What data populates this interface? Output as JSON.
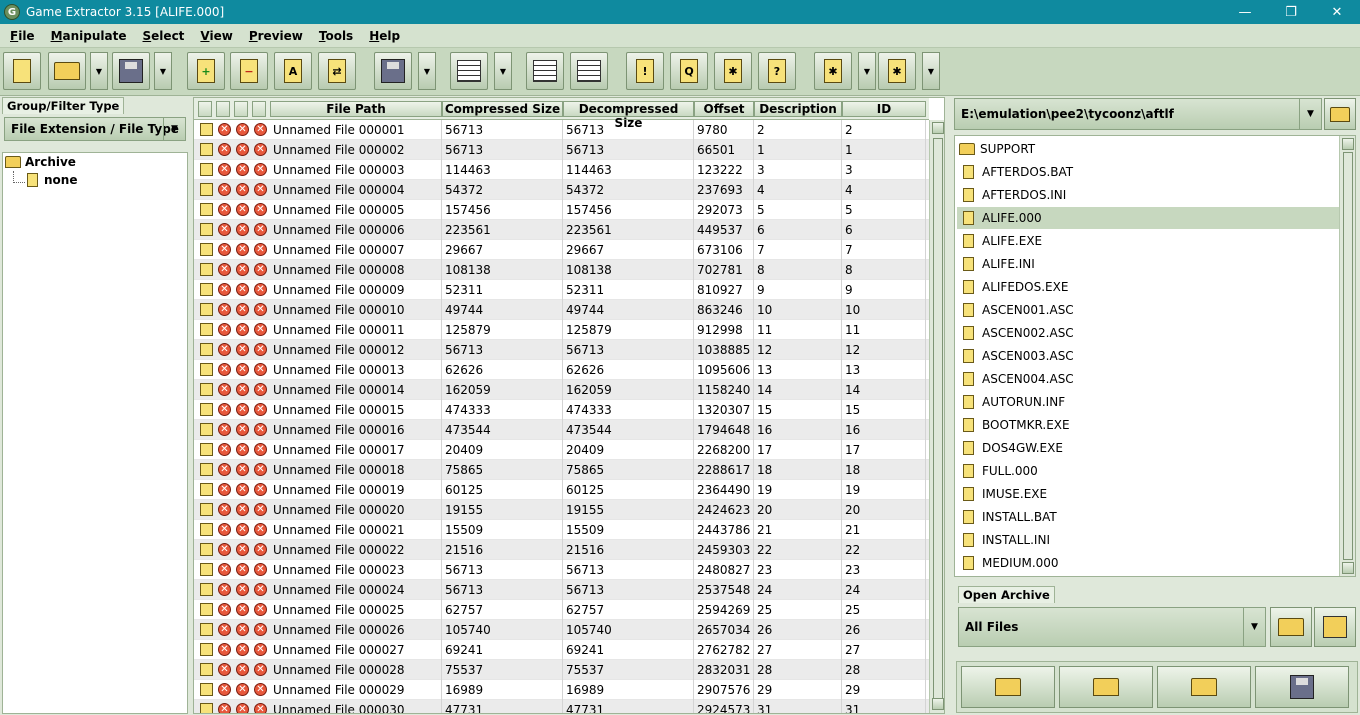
{
  "window": {
    "title": "Game Extractor 3.15 [ALIFE.000]",
    "minimize": "—",
    "maximize": "❐",
    "close": "✕"
  },
  "menu": [
    "File",
    "Manipulate",
    "Select",
    "View",
    "Preview",
    "Tools",
    "Help"
  ],
  "menu_underline": [
    "F",
    "M",
    "S",
    "V",
    "P",
    "T",
    "H"
  ],
  "toolbar": {
    "icons": [
      "new-archive-icon",
      "open-archive-icon",
      "open-dropdown-icon",
      "save-archive-icon",
      "save-dropdown-icon",
      "add-files-icon",
      "remove-files-icon",
      "rename-files-icon",
      "replace-files-icon",
      "extract-icon",
      "extract-dropdown-icon",
      "table-view-icon",
      "view-dropdown-icon",
      "tree-view-icon",
      "thumbnail-view-icon",
      "plugin-icon",
      "search-icon",
      "options-icon",
      "help-icon",
      "script-icon",
      "script-dropdown-icon",
      "settings-icon",
      "settings-dropdown-icon"
    ]
  },
  "left_panel": {
    "tab": "Group/Filter Type",
    "filter_value": "File Extension / File Type",
    "tree_root": "Archive",
    "tree_child": "none"
  },
  "table": {
    "columns": [
      "File Path",
      "Compressed Size",
      "Decompressed Size",
      "Offset",
      "Description",
      "ID"
    ],
    "rows": [
      [
        "Unnamed File 000001",
        "56713",
        "56713",
        "9780",
        "2",
        "2"
      ],
      [
        "Unnamed File 000002",
        "56713",
        "56713",
        "66501",
        "1",
        "1"
      ],
      [
        "Unnamed File 000003",
        "114463",
        "114463",
        "123222",
        "3",
        "3"
      ],
      [
        "Unnamed File 000004",
        "54372",
        "54372",
        "237693",
        "4",
        "4"
      ],
      [
        "Unnamed File 000005",
        "157456",
        "157456",
        "292073",
        "5",
        "5"
      ],
      [
        "Unnamed File 000006",
        "223561",
        "223561",
        "449537",
        "6",
        "6"
      ],
      [
        "Unnamed File 000007",
        "29667",
        "29667",
        "673106",
        "7",
        "7"
      ],
      [
        "Unnamed File 000008",
        "108138",
        "108138",
        "702781",
        "8",
        "8"
      ],
      [
        "Unnamed File 000009",
        "52311",
        "52311",
        "810927",
        "9",
        "9"
      ],
      [
        "Unnamed File 000010",
        "49744",
        "49744",
        "863246",
        "10",
        "10"
      ],
      [
        "Unnamed File 000011",
        "125879",
        "125879",
        "912998",
        "11",
        "11"
      ],
      [
        "Unnamed File 000012",
        "56713",
        "56713",
        "1038885",
        "12",
        "12"
      ],
      [
        "Unnamed File 000013",
        "62626",
        "62626",
        "1095606",
        "13",
        "13"
      ],
      [
        "Unnamed File 000014",
        "162059",
        "162059",
        "1158240",
        "14",
        "14"
      ],
      [
        "Unnamed File 000015",
        "474333",
        "474333",
        "1320307",
        "15",
        "15"
      ],
      [
        "Unnamed File 000016",
        "473544",
        "473544",
        "1794648",
        "16",
        "16"
      ],
      [
        "Unnamed File 000017",
        "20409",
        "20409",
        "2268200",
        "17",
        "17"
      ],
      [
        "Unnamed File 000018",
        "75865",
        "75865",
        "2288617",
        "18",
        "18"
      ],
      [
        "Unnamed File 000019",
        "60125",
        "60125",
        "2364490",
        "19",
        "19"
      ],
      [
        "Unnamed File 000020",
        "19155",
        "19155",
        "2424623",
        "20",
        "20"
      ],
      [
        "Unnamed File 000021",
        "15509",
        "15509",
        "2443786",
        "21",
        "21"
      ],
      [
        "Unnamed File 000022",
        "21516",
        "21516",
        "2459303",
        "22",
        "22"
      ],
      [
        "Unnamed File 000023",
        "56713",
        "56713",
        "2480827",
        "23",
        "23"
      ],
      [
        "Unnamed File 000024",
        "56713",
        "56713",
        "2537548",
        "24",
        "24"
      ],
      [
        "Unnamed File 000025",
        "62757",
        "62757",
        "2594269",
        "25",
        "25"
      ],
      [
        "Unnamed File 000026",
        "105740",
        "105740",
        "2657034",
        "26",
        "26"
      ],
      [
        "Unnamed File 000027",
        "69241",
        "69241",
        "2762782",
        "27",
        "27"
      ],
      [
        "Unnamed File 000028",
        "75537",
        "75537",
        "2832031",
        "28",
        "28"
      ],
      [
        "Unnamed File 000029",
        "16989",
        "16989",
        "2907576",
        "29",
        "29"
      ],
      [
        "Unnamed File 000030",
        "47731",
        "47731",
        "2924573",
        "31",
        "31"
      ]
    ]
  },
  "right_panel": {
    "path": "E:\\emulation\\pee2\\tycoonz\\aftlf",
    "files": [
      "SUPPORT",
      "AFTERDOS.BAT",
      "AFTERDOS.INI",
      "ALIFE.000",
      "ALIFE.EXE",
      "ALIFE.INI",
      "ALIFEDOS.EXE",
      "ASCEN001.ASC",
      "ASCEN002.ASC",
      "ASCEN003.ASC",
      "ASCEN004.ASC",
      "AUTORUN.INF",
      "BOOTMKR.EXE",
      "DOS4GW.EXE",
      "FULL.000",
      "IMUSE.EXE",
      "INSTALL.BAT",
      "INSTALL.INI",
      "MEDIUM.000"
    ],
    "selected": "ALIFE.000",
    "open_archive_tab": "Open Archive",
    "file_filter": "All Files",
    "bottom_buttons": [
      "open-archive-icon",
      "add-files-icon",
      "replace-files-icon",
      "save-archive-icon"
    ]
  }
}
